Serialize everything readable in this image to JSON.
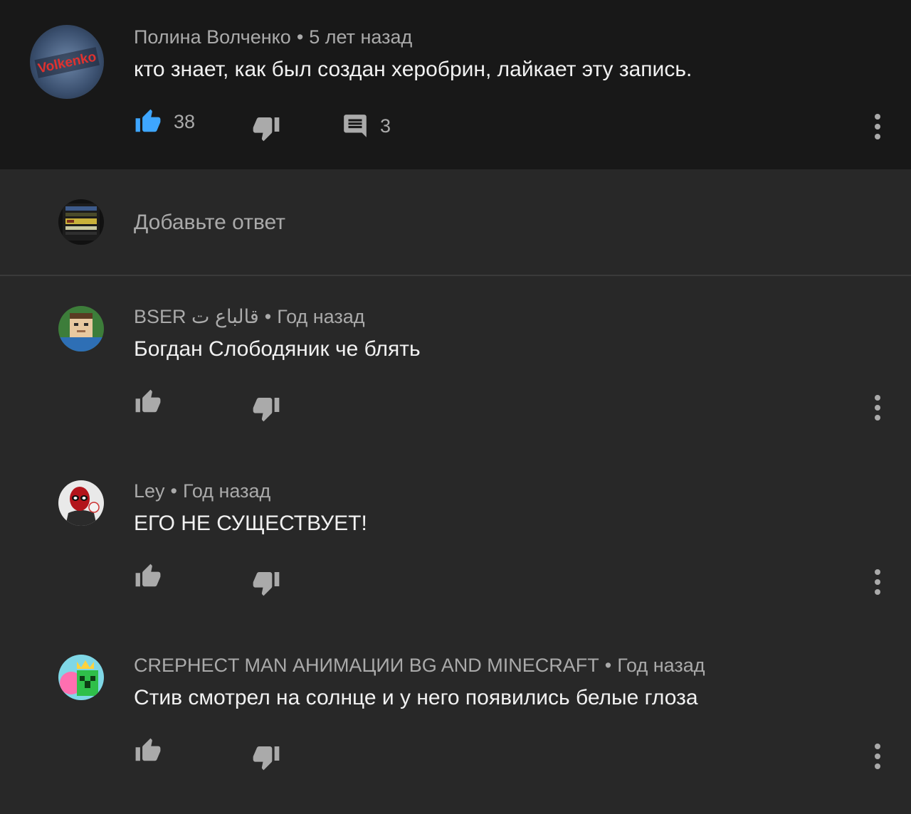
{
  "top_comment": {
    "author": "Полина Волченко",
    "time": "5 лет назад",
    "text": "кто знает, как был создан херобрин, лайкает эту запись.",
    "likes": "38",
    "replies": "3",
    "like_active": true,
    "avatar_text": "Volkenko"
  },
  "reply_box": {
    "placeholder": "Добавьте ответ"
  },
  "replies": [
    {
      "author": "BSER قالباع ت",
      "time": "Год назад",
      "text": "Богдан Слободяник че блять"
    },
    {
      "author": "Ley",
      "time": "Год назад",
      "text": "ЕГО НЕ СУЩЕСТВУЕТ!"
    },
    {
      "author": "СREPHECT MAN АНИМАЦИИ BG AND MINECRAFT",
      "time": "Год назад",
      "text": "Стив смотрел на солнце и у него появились белые глоза"
    }
  ],
  "colors": {
    "accent": "#3ea6ff",
    "icon": "#aaaaaa",
    "top_bg": "#181818",
    "page_bg": "#282828"
  }
}
